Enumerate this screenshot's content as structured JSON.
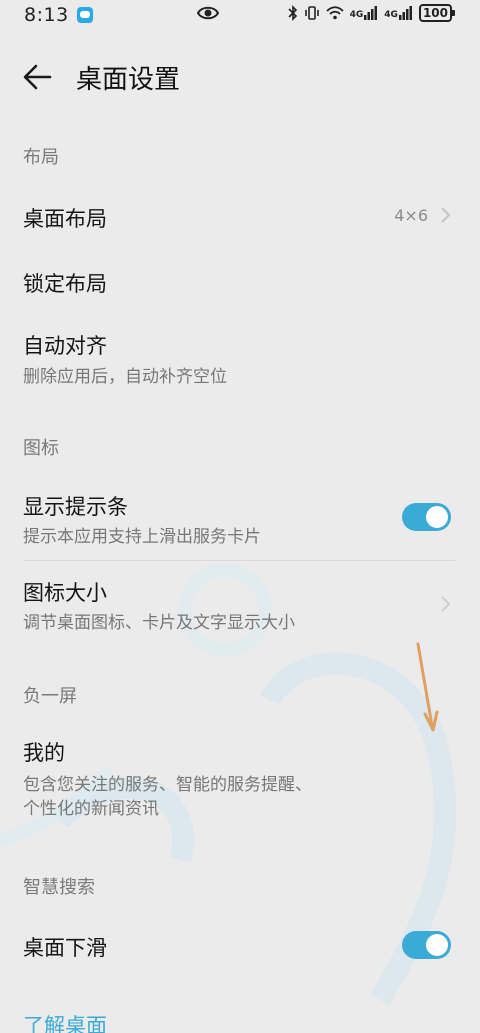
{
  "status_bar": {
    "time": "8:13",
    "net1": "4G",
    "net2": "4G",
    "battery": "100"
  },
  "header": {
    "title": "桌面设置"
  },
  "sections": {
    "layout": "布局",
    "icons": "图标",
    "minus_one": "负一屏",
    "smart_search": "智慧搜索"
  },
  "items": {
    "desktop_layout": {
      "title": "桌面布局",
      "value": "4×6"
    },
    "lock_layout": {
      "title": "锁定布局"
    },
    "auto_align": {
      "title": "自动对齐",
      "subtitle": "删除应用后，自动补齐空位"
    },
    "show_hint_bar": {
      "title": "显示提示条",
      "subtitle": "提示本应用支持上滑出服务卡片",
      "enabled": true
    },
    "icon_size": {
      "title": "图标大小",
      "subtitle": "调节桌面图标、卡片及文字显示大小"
    },
    "mine": {
      "title": "我的",
      "subtitle_line1": "包含您关注的服务、智能的服务提醒、",
      "subtitle_line2": "个性化的新闻资讯"
    },
    "desktop_swipe_down": {
      "title": "桌面下滑",
      "enabled": true
    }
  },
  "footer": {
    "learn_link": "了解桌面"
  },
  "colors": {
    "accent": "#3aabd6",
    "background": "#ebebec",
    "annotation_arrow": "#e0a060"
  }
}
